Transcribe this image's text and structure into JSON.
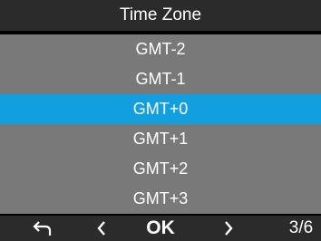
{
  "header": {
    "title": "Time Zone"
  },
  "list": {
    "items": [
      {
        "label": "GMT-2",
        "selected": false
      },
      {
        "label": "GMT-1",
        "selected": false
      },
      {
        "label": "GMT+0",
        "selected": true
      },
      {
        "label": "GMT+1",
        "selected": false
      },
      {
        "label": "GMT+2",
        "selected": false
      },
      {
        "label": "GMT+3",
        "selected": false
      }
    ]
  },
  "footer": {
    "back_icon": "return-arrow-icon",
    "prev_icon": "chevron-left-icon",
    "ok_label": "OK",
    "next_icon": "chevron-right-icon",
    "page_indicator": "3/6"
  },
  "colors": {
    "selected": "#119fe0",
    "list_background": "#797979",
    "bar_background": "#2b2b2b"
  }
}
